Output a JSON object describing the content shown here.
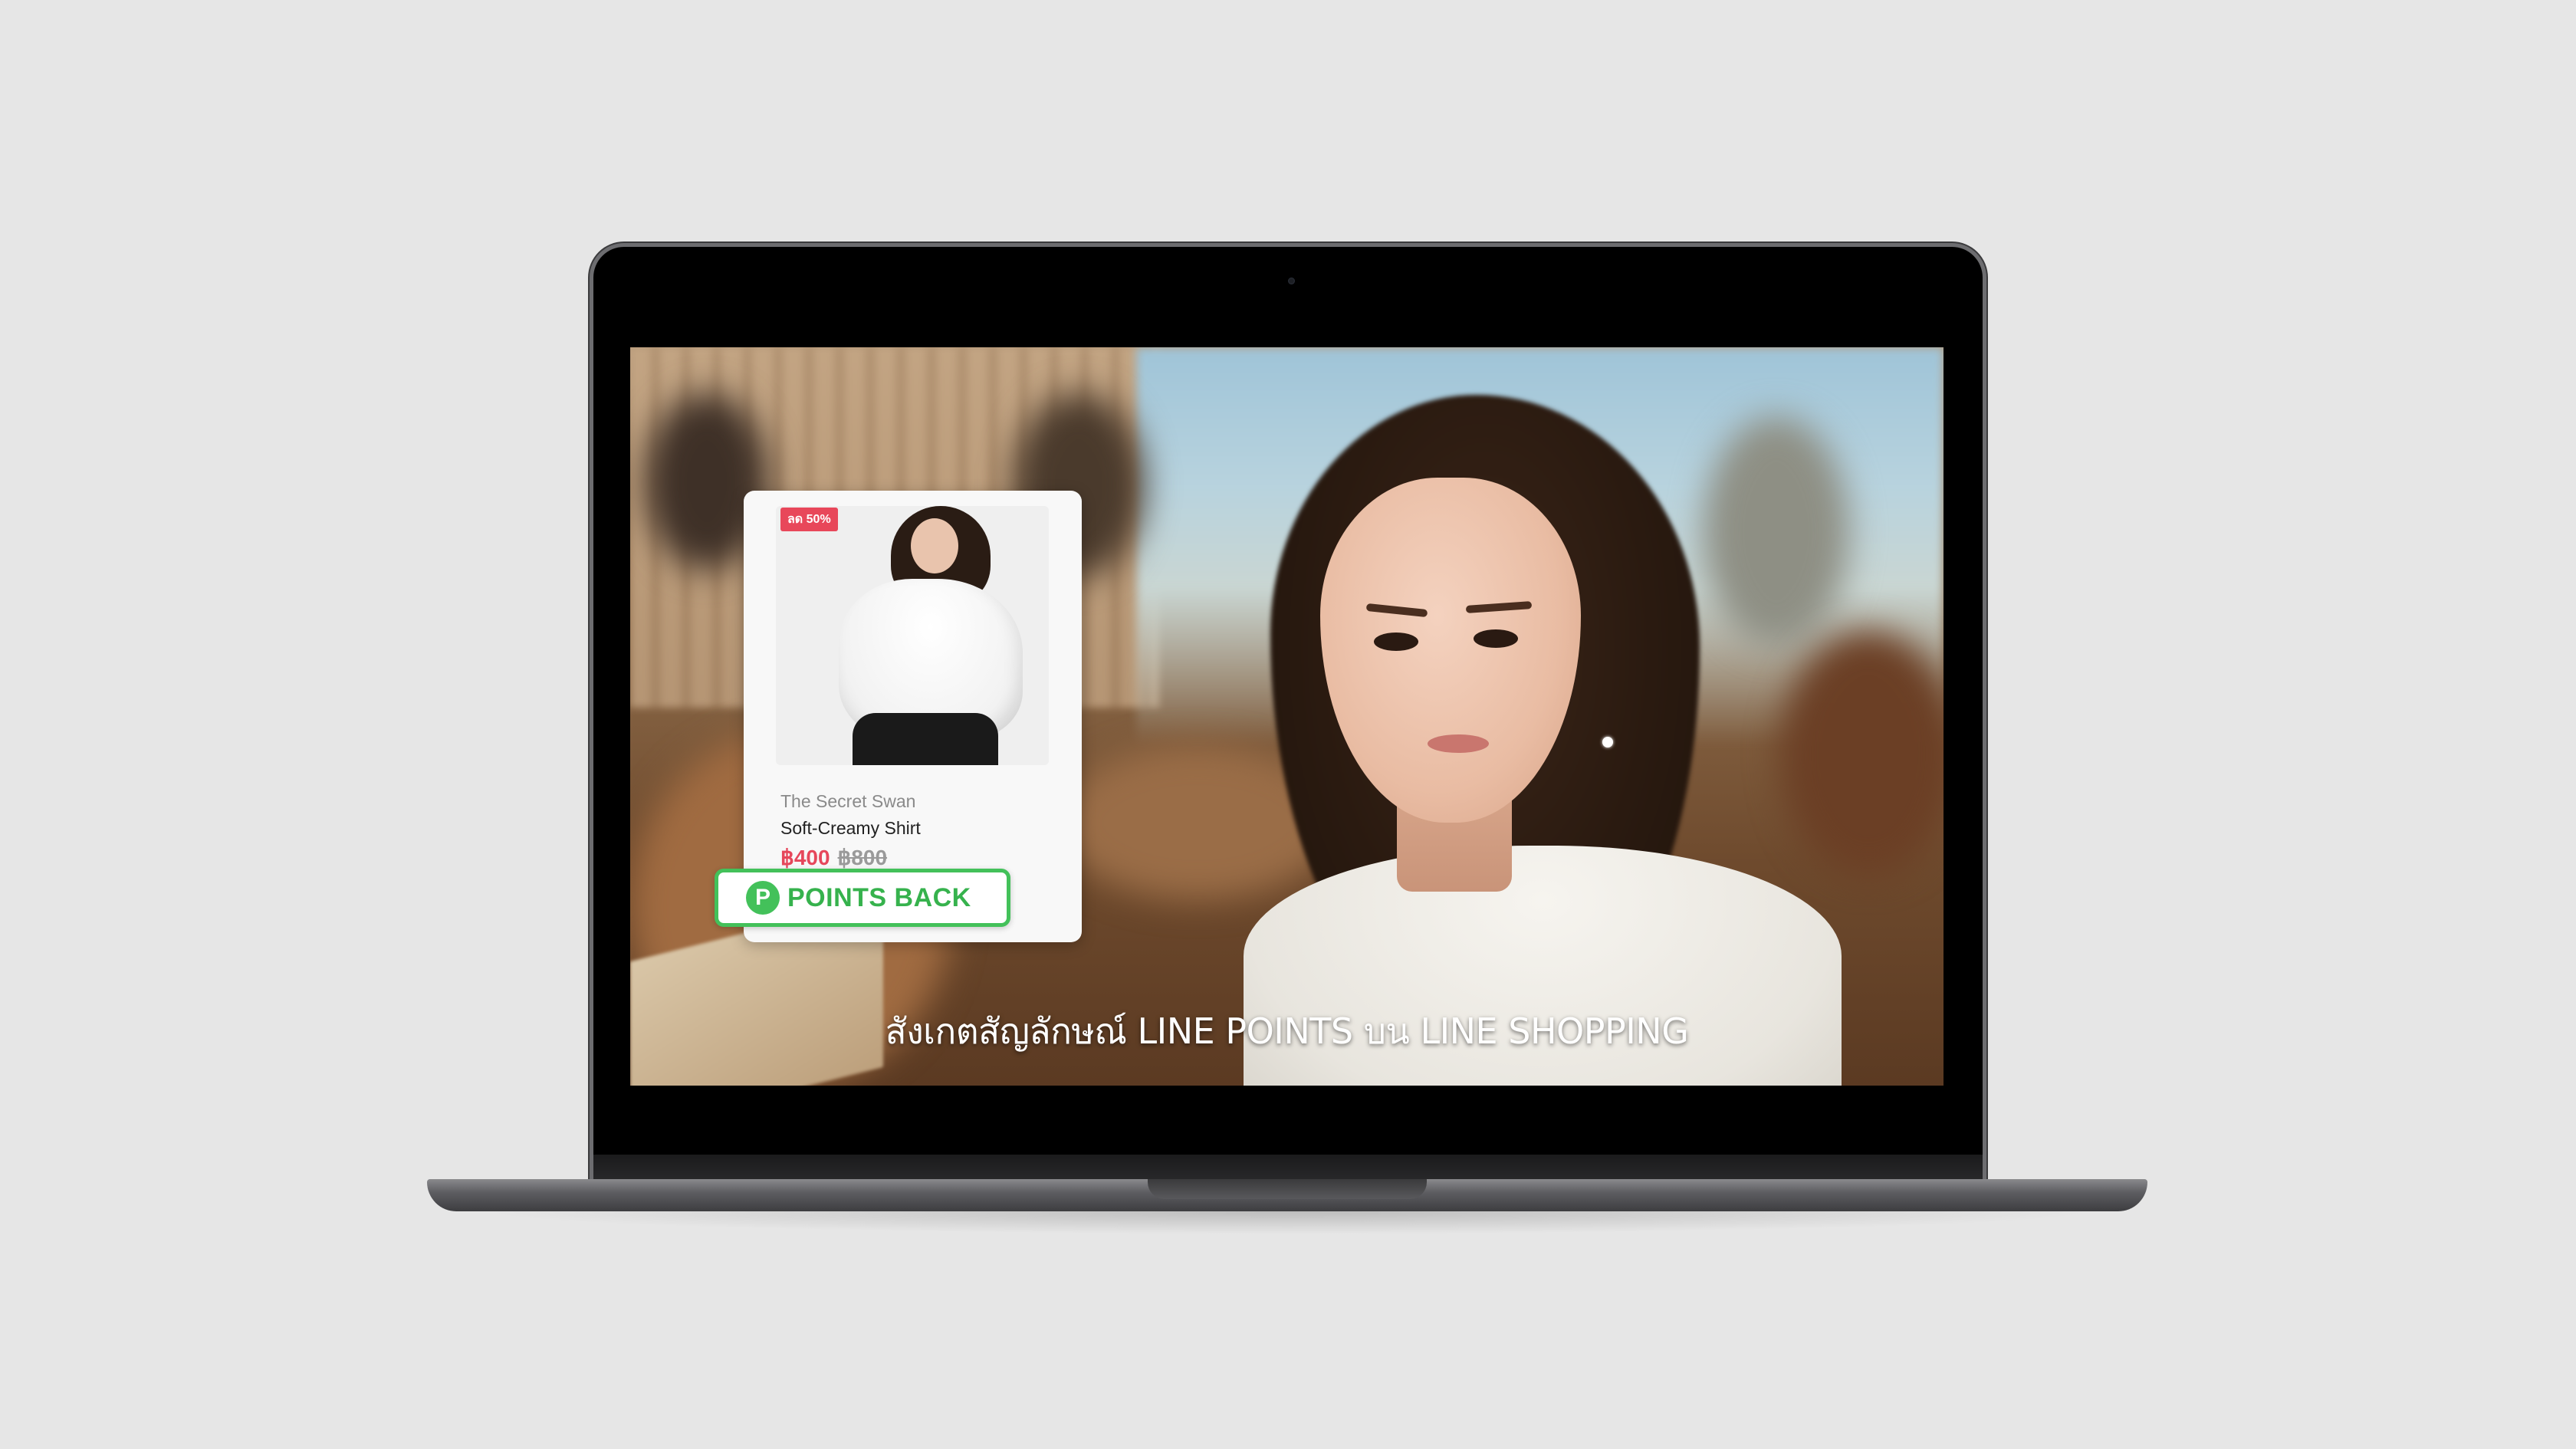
{
  "product_card": {
    "discount_badge": "ลด 50%",
    "brand": "The Secret Swan",
    "name": "Soft-Creamy Shirt",
    "price_sale": "฿400",
    "price_original": "฿800"
  },
  "points_badge": {
    "icon": "P",
    "label": "POINTS BACK"
  },
  "subtitle": "สังเกตสัญลักษณ์ LINE POINTS บน LINE SHOPPING",
  "colors": {
    "background": "#e6e6e6",
    "points_green": "#43c15a",
    "sale_red": "#e6475b",
    "badge_red": "#e8475a"
  }
}
